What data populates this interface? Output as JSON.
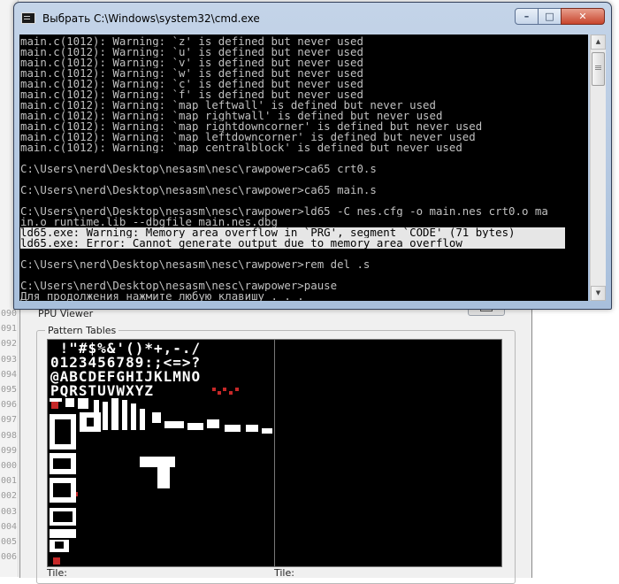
{
  "editor": {
    "line_numbers": [
      "090",
      "091",
      "092",
      "093",
      "094",
      "095",
      "096",
      "097",
      "098",
      "099",
      "000",
      "001",
      "002",
      "003",
      "004",
      "005",
      "006"
    ]
  },
  "ppu_viewer": {
    "title": "PPU Viewer",
    "group_label": "Pattern Tables",
    "left_tile_label": "Tile:",
    "right_tile_label": "Tile:",
    "font_rows": [
      " !\"#$%&'()*+,-./",
      "0123456789:;<=>?",
      "@ABCDEFGHIJKLMNO",
      "PQRSTUVWXYZ"
    ]
  },
  "cmd": {
    "title": "Выбрать C:\\Windows\\system32\\cmd.exe",
    "buttons": {
      "minimize": "–",
      "maximize": "□",
      "close": "✕"
    },
    "lines": [
      "main.c(1012): Warning: `z' is defined but never used",
      "main.c(1012): Warning: `u' is defined but never used",
      "main.c(1012): Warning: `v' is defined but never used",
      "main.c(1012): Warning: `w' is defined but never used",
      "main.c(1012): Warning: `c' is defined but never used",
      "main.c(1012): Warning: `f' is defined but never used",
      "main.c(1012): Warning: `map_leftwall' is defined but never used",
      "main.c(1012): Warning: `map_rightwall' is defined but never used",
      "main.c(1012): Warning: `map_rightdowncorner' is defined but never used",
      "main.c(1012): Warning: `map_leftdowncorner' is defined but never used",
      "main.c(1012): Warning: `map_centralblock' is defined but never used",
      "",
      "C:\\Users\\nerd\\Desktop\\nesasm\\nesc\\rawpower>ca65 crt0.s",
      "",
      "C:\\Users\\nerd\\Desktop\\nesasm\\nesc\\rawpower>ca65 main.s",
      "",
      "C:\\Users\\nerd\\Desktop\\nesasm\\nesc\\rawpower>ld65 -C nes.cfg -o main.nes crt0.o ma",
      "in.o runtime.lib --dbgfile main.nes.dbg",
      "ld65.exe: Warning: Memory area overflow in `PRG', segment `CODE' (71 bytes)",
      "ld65.exe: Error: Cannot generate output due to memory area overflow",
      "",
      "C:\\Users\\nerd\\Desktop\\nesasm\\nesc\\rawpower>rem del .s",
      "",
      "C:\\Users\\nerd\\Desktop\\nesasm\\nesc\\rawpower>pause",
      "Для продолжения нажмите любую клавишу . . ."
    ],
    "highlighted_lines": [
      18,
      19
    ]
  }
}
